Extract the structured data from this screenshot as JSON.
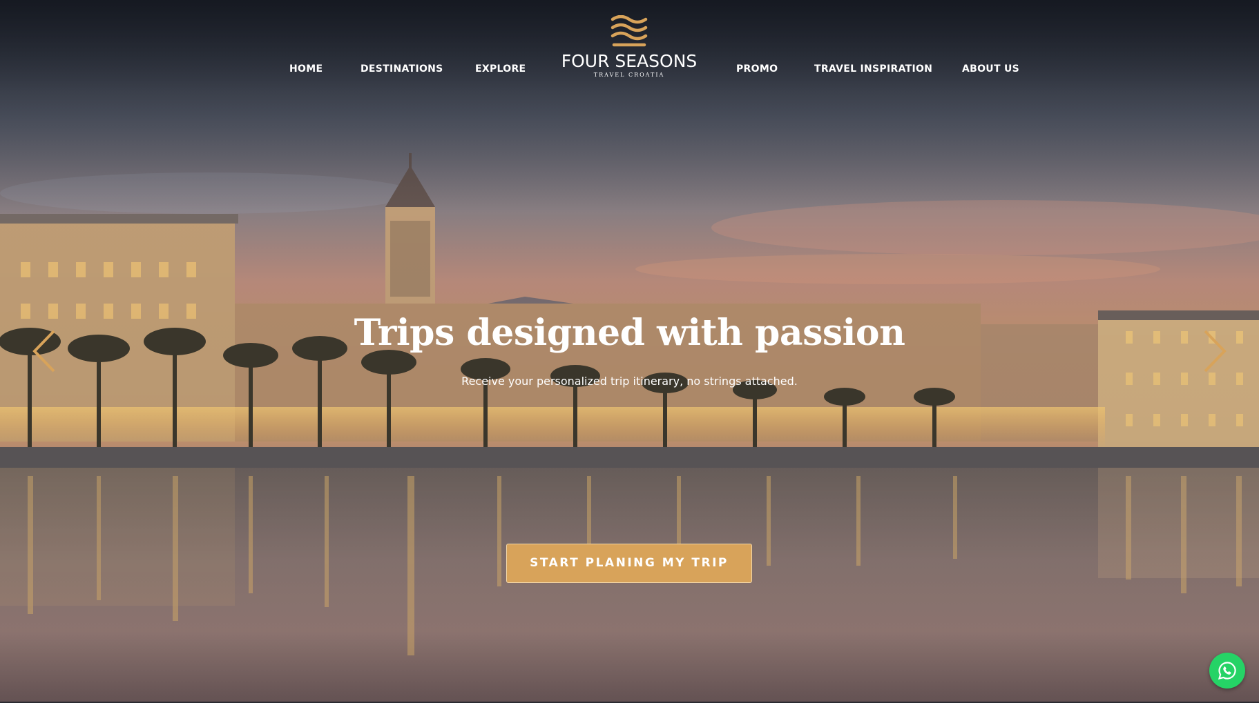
{
  "nav": {
    "items": [
      {
        "label": "HOME"
      },
      {
        "label": "DESTINATIONS"
      },
      {
        "label": "EXPLORE"
      },
      {
        "label": "PROMO"
      },
      {
        "label": "TRAVEL INSPIRATION"
      },
      {
        "label": "ABOUT US"
      }
    ]
  },
  "brand": {
    "name": "FOUR SEASONS",
    "tagline": "TRAVEL CROATIA",
    "accent_color": "#d8a35a"
  },
  "hero": {
    "headline": "Trips designed with passion",
    "subtext": "Receive your personalized trip itinerary, no strings attached.",
    "cta_label": "START PLANING MY TRIP",
    "prev_icon": "chevron-left-icon",
    "next_icon": "chevron-right-icon"
  },
  "chat": {
    "icon": "whatsapp-icon",
    "color": "#25d366"
  }
}
